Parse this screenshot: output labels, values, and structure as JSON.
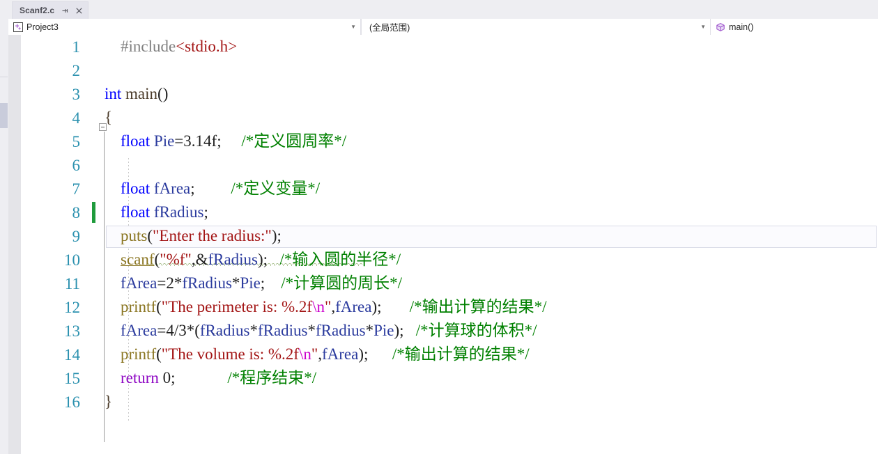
{
  "window": {
    "app": "Visual Studio",
    "tab": {
      "label": "Scanf2.c",
      "pin_icon": "pin-icon",
      "close_icon": "close-icon"
    }
  },
  "navbar": {
    "project": {
      "icon": "project-icon",
      "label": "Project3",
      "dropdown_icon": "chevron-down-icon"
    },
    "scope": {
      "label": "(全局范围)",
      "dropdown_icon": "chevron-down-icon"
    },
    "member": {
      "icon": "method-cube-icon",
      "label": "main()"
    }
  },
  "editor": {
    "language": "C",
    "current_line": 9,
    "changed_lines": [
      8
    ],
    "fold_start_line": 3,
    "fold_end_line": 16,
    "lines": [
      {
        "n": "1",
        "tokens": [
          {
            "t": "    ",
            "c": "k-punct"
          },
          {
            "t": "#include",
            "c": "k-pre"
          },
          {
            "t": "<stdio.h>",
            "c": "k-inc"
          }
        ]
      },
      {
        "n": "2",
        "tokens": []
      },
      {
        "n": "3",
        "tokens": [
          {
            "t": "int",
            "c": "k-type"
          },
          {
            "t": " ",
            "c": "k-punct"
          },
          {
            "t": "main",
            "c": "k-id"
          },
          {
            "t": "()",
            "c": "k-punct"
          }
        ]
      },
      {
        "n": "4",
        "tokens": [
          {
            "t": "{",
            "c": "k-id"
          }
        ]
      },
      {
        "n": "5",
        "tokens": [
          {
            "t": "    ",
            "c": "k-punct"
          },
          {
            "t": "float",
            "c": "k-type"
          },
          {
            "t": " ",
            "c": "k-punct"
          },
          {
            "t": "Pie",
            "c": "k-var"
          },
          {
            "t": "=",
            "c": "k-punct"
          },
          {
            "t": "3.14f",
            "c": "k-num"
          },
          {
            "t": ";",
            "c": "k-punct"
          },
          {
            "t": "     ",
            "c": "k-punct"
          },
          {
            "t": "/*定义圆周率*/",
            "c": "k-cmt"
          }
        ]
      },
      {
        "n": "6",
        "tokens": []
      },
      {
        "n": "7",
        "tokens": [
          {
            "t": "    ",
            "c": "k-punct"
          },
          {
            "t": "float",
            "c": "k-type"
          },
          {
            "t": " ",
            "c": "k-punct"
          },
          {
            "t": "fArea",
            "c": "k-var"
          },
          {
            "t": ";",
            "c": "k-punct"
          },
          {
            "t": "         ",
            "c": "k-punct"
          },
          {
            "t": "/*定义变量*/",
            "c": "k-cmt"
          }
        ]
      },
      {
        "n": "8",
        "tokens": [
          {
            "t": "    ",
            "c": "k-punct"
          },
          {
            "t": "float",
            "c": "k-type"
          },
          {
            "t": " ",
            "c": "k-punct"
          },
          {
            "t": "fRadius",
            "c": "k-var"
          },
          {
            "t": ";",
            "c": "k-punct"
          }
        ]
      },
      {
        "n": "9",
        "tokens": [
          {
            "t": "    ",
            "c": "k-punct"
          },
          {
            "t": "puts",
            "c": "k-fn"
          },
          {
            "t": "(",
            "c": "k-punct"
          },
          {
            "t": "\"Enter the radius:\"",
            "c": "k-str"
          },
          {
            "t": ");",
            "c": "k-punct"
          }
        ]
      },
      {
        "n": "10",
        "tokens": [
          {
            "t": "    ",
            "c": "k-punct"
          },
          {
            "t": "scanf",
            "c": "k-fn underline-fn"
          },
          {
            "t": "(",
            "c": "k-punct"
          },
          {
            "t": "\"%f\"",
            "c": "k-str"
          },
          {
            "t": ",&",
            "c": "k-punct"
          },
          {
            "t": "fRadius",
            "c": "k-var"
          },
          {
            "t": ");",
            "c": "k-punct"
          },
          {
            "t": "   ",
            "c": "k-punct"
          },
          {
            "t": "/*输入圆的半径*/",
            "c": "k-cmt"
          }
        ]
      },
      {
        "n": "11",
        "tokens": [
          {
            "t": "    ",
            "c": "k-punct"
          },
          {
            "t": "fArea",
            "c": "k-var"
          },
          {
            "t": "=2*",
            "c": "k-punct"
          },
          {
            "t": "fRadius",
            "c": "k-var"
          },
          {
            "t": "*",
            "c": "k-punct"
          },
          {
            "t": "Pie",
            "c": "k-var"
          },
          {
            "t": ";",
            "c": "k-punct"
          },
          {
            "t": "    ",
            "c": "k-punct"
          },
          {
            "t": "/*计算圆的周长*/",
            "c": "k-cmt"
          }
        ]
      },
      {
        "n": "12",
        "tokens": [
          {
            "t": "    ",
            "c": "k-punct"
          },
          {
            "t": "printf",
            "c": "k-fn"
          },
          {
            "t": "(",
            "c": "k-punct"
          },
          {
            "t": "\"The perimeter is: %.2f",
            "c": "k-str"
          },
          {
            "t": "\\n",
            "c": "k-esc"
          },
          {
            "t": "\"",
            "c": "k-str"
          },
          {
            "t": ",",
            "c": "k-punct"
          },
          {
            "t": "fArea",
            "c": "k-var"
          },
          {
            "t": ");",
            "c": "k-punct"
          },
          {
            "t": "       ",
            "c": "k-punct"
          },
          {
            "t": "/*输出计算的结果*/",
            "c": "k-cmt"
          }
        ]
      },
      {
        "n": "13",
        "tokens": [
          {
            "t": "    ",
            "c": "k-punct"
          },
          {
            "t": "fArea",
            "c": "k-var"
          },
          {
            "t": "=4/3*(",
            "c": "k-punct"
          },
          {
            "t": "fRadius",
            "c": "k-var"
          },
          {
            "t": "*",
            "c": "k-punct"
          },
          {
            "t": "fRadius",
            "c": "k-var"
          },
          {
            "t": "*",
            "c": "k-punct"
          },
          {
            "t": "fRadius",
            "c": "k-var"
          },
          {
            "t": "*",
            "c": "k-punct"
          },
          {
            "t": "Pie",
            "c": "k-var"
          },
          {
            "t": ");",
            "c": "k-punct"
          },
          {
            "t": "   ",
            "c": "k-punct"
          },
          {
            "t": "/*计算球的体积*/",
            "c": "k-cmt"
          }
        ]
      },
      {
        "n": "14",
        "tokens": [
          {
            "t": "    ",
            "c": "k-punct"
          },
          {
            "t": "printf",
            "c": "k-fn"
          },
          {
            "t": "(",
            "c": "k-punct"
          },
          {
            "t": "\"The volume is: %.2f",
            "c": "k-str"
          },
          {
            "t": "\\n",
            "c": "k-esc"
          },
          {
            "t": "\"",
            "c": "k-str"
          },
          {
            "t": ",",
            "c": "k-punct"
          },
          {
            "t": "fArea",
            "c": "k-var"
          },
          {
            "t": ");",
            "c": "k-punct"
          },
          {
            "t": "      ",
            "c": "k-punct"
          },
          {
            "t": "/*输出计算的结果*/",
            "c": "k-cmt"
          }
        ]
      },
      {
        "n": "15",
        "tokens": [
          {
            "t": "    ",
            "c": "k-punct"
          },
          {
            "t": "return",
            "c": "k-kw"
          },
          {
            "t": " 0;",
            "c": "k-punct"
          },
          {
            "t": "             ",
            "c": "k-punct"
          },
          {
            "t": "/*程序结束*/",
            "c": "k-cmt"
          }
        ]
      },
      {
        "n": "16",
        "tokens": [
          {
            "t": "}",
            "c": "k-id"
          }
        ]
      }
    ]
  },
  "colors": {
    "comment": "#008000",
    "string": "#a31515",
    "type_keyword": "#0000ff",
    "keyword": "#8f08c4",
    "function": "#8a7521",
    "variable": "#2b3b9e",
    "escape": "#cc00cc",
    "preprocessor": "#808080",
    "line_number": "#2b91af",
    "change_bar": "#1f9b3c",
    "chrome": "#eeeef2"
  }
}
